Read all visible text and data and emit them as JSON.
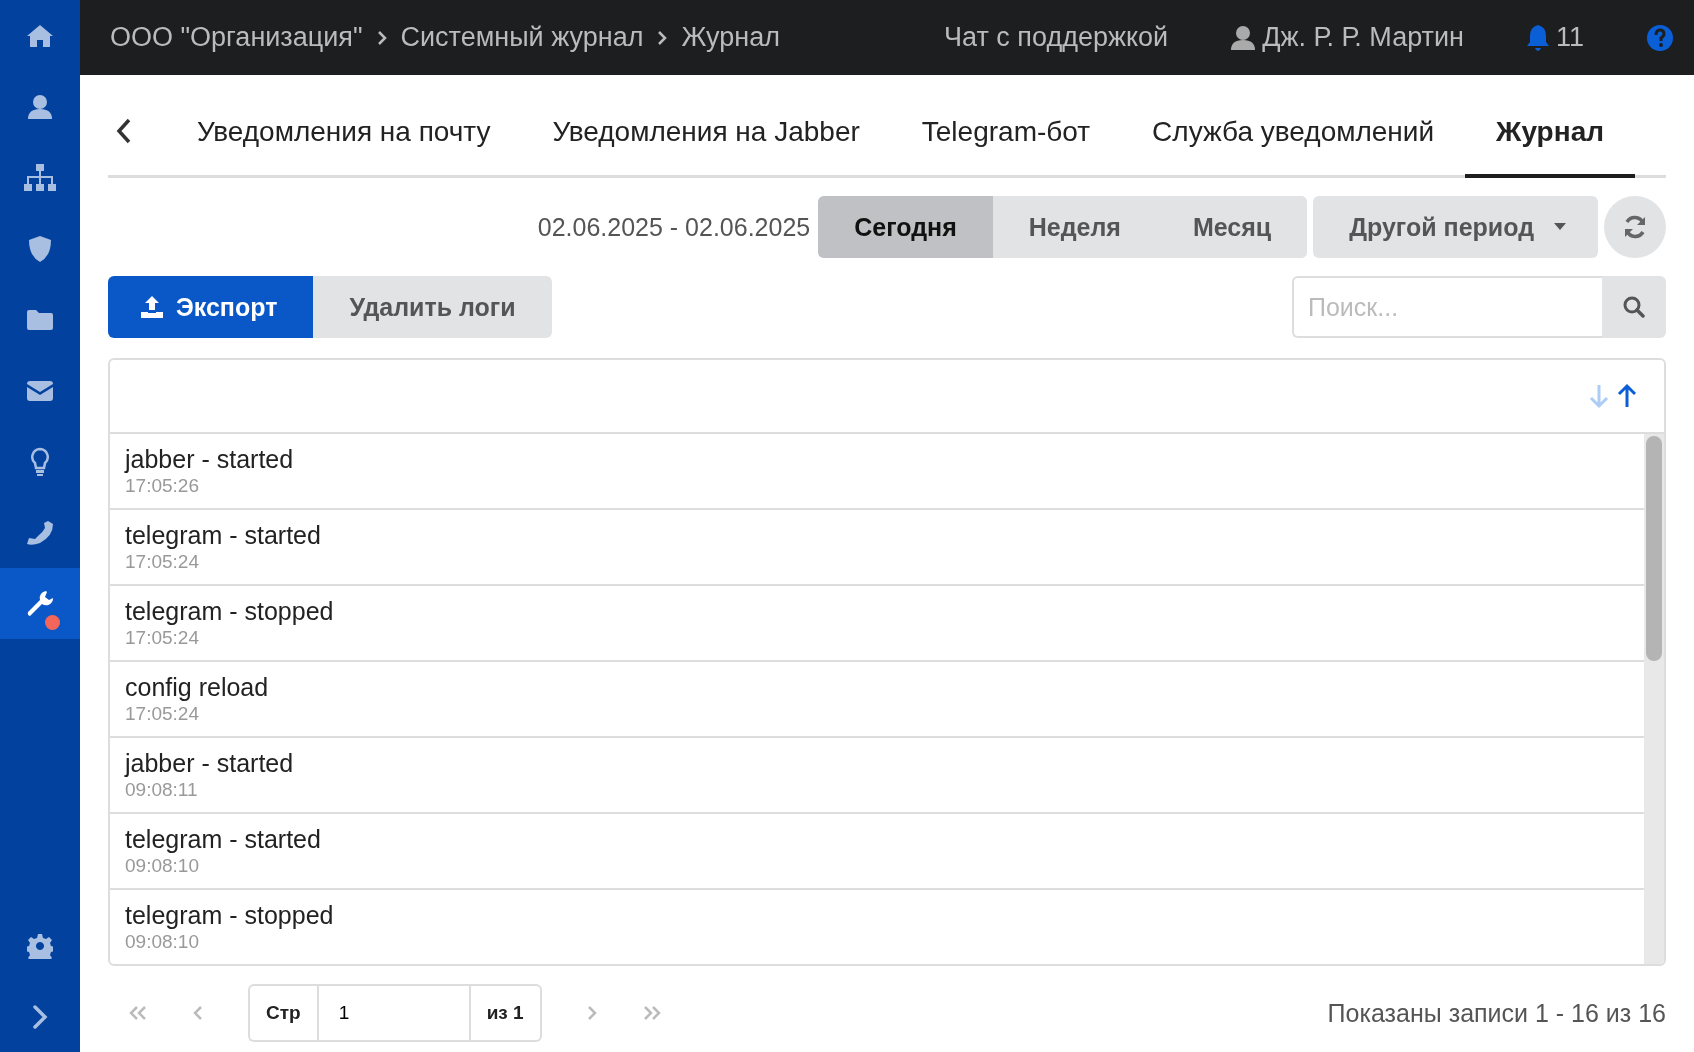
{
  "sidebar": {
    "items": [
      {
        "kind": "home",
        "selected": false,
        "badge": false
      },
      {
        "kind": "user",
        "selected": false,
        "badge": false
      },
      {
        "kind": "sitemap",
        "selected": false,
        "badge": false
      },
      {
        "kind": "shield",
        "selected": false,
        "badge": false
      },
      {
        "kind": "folder",
        "selected": false,
        "badge": false
      },
      {
        "kind": "mail",
        "selected": false,
        "badge": false
      },
      {
        "kind": "bulb",
        "selected": false,
        "badge": false
      },
      {
        "kind": "phone",
        "selected": false,
        "badge": false
      },
      {
        "kind": "wrench",
        "selected": true,
        "badge": true
      }
    ],
    "bottom": [
      {
        "kind": "gear"
      },
      {
        "kind": "chevron"
      }
    ]
  },
  "header": {
    "breadcrumbs": [
      "ООО \"Организация\"",
      "Системный журнал",
      "Журнал"
    ],
    "support": "Чат с поддержкой",
    "user": "Дж. Р. Р. Мартин",
    "notifications": "11"
  },
  "tabs": [
    {
      "label": "Уведомления на почту",
      "selected": false
    },
    {
      "label": "Уведомления на Jabber",
      "selected": false
    },
    {
      "label": "Telegram-бот",
      "selected": false
    },
    {
      "label": "Служба уведомлений",
      "selected": false
    },
    {
      "label": "Журнал",
      "selected": true
    }
  ],
  "period": {
    "range": "02.06.2025 - 02.06.2025",
    "options": [
      {
        "label": "Сегодня",
        "selected": true
      },
      {
        "label": "Неделя",
        "selected": false
      },
      {
        "label": "Месяц",
        "selected": false
      }
    ],
    "other": "Другой период"
  },
  "toolbar": {
    "export": "Экспорт",
    "delete": "Удалить логи",
    "search": {
      "placeholder": "Поиск..."
    }
  },
  "sort": {
    "ascending": true
  },
  "log": [
    {
      "title": "jabber - started",
      "time": "17:05:26"
    },
    {
      "title": "telegram - started",
      "time": "17:05:24"
    },
    {
      "title": "telegram - stopped",
      "time": "17:05:24"
    },
    {
      "title": "config reload",
      "time": "17:05:24"
    },
    {
      "title": "jabber - started",
      "time": "09:08:11"
    },
    {
      "title": "telegram - started",
      "time": "09:08:10"
    },
    {
      "title": "telegram - stopped",
      "time": "09:08:10"
    }
  ],
  "pager": {
    "first_disabled": true,
    "prev_disabled": true,
    "next_disabled": true,
    "last_disabled": true,
    "page_label": "Стр",
    "page": "1",
    "of": "из 1",
    "summary": "Показаны записи 1 - 16 из 16"
  }
}
